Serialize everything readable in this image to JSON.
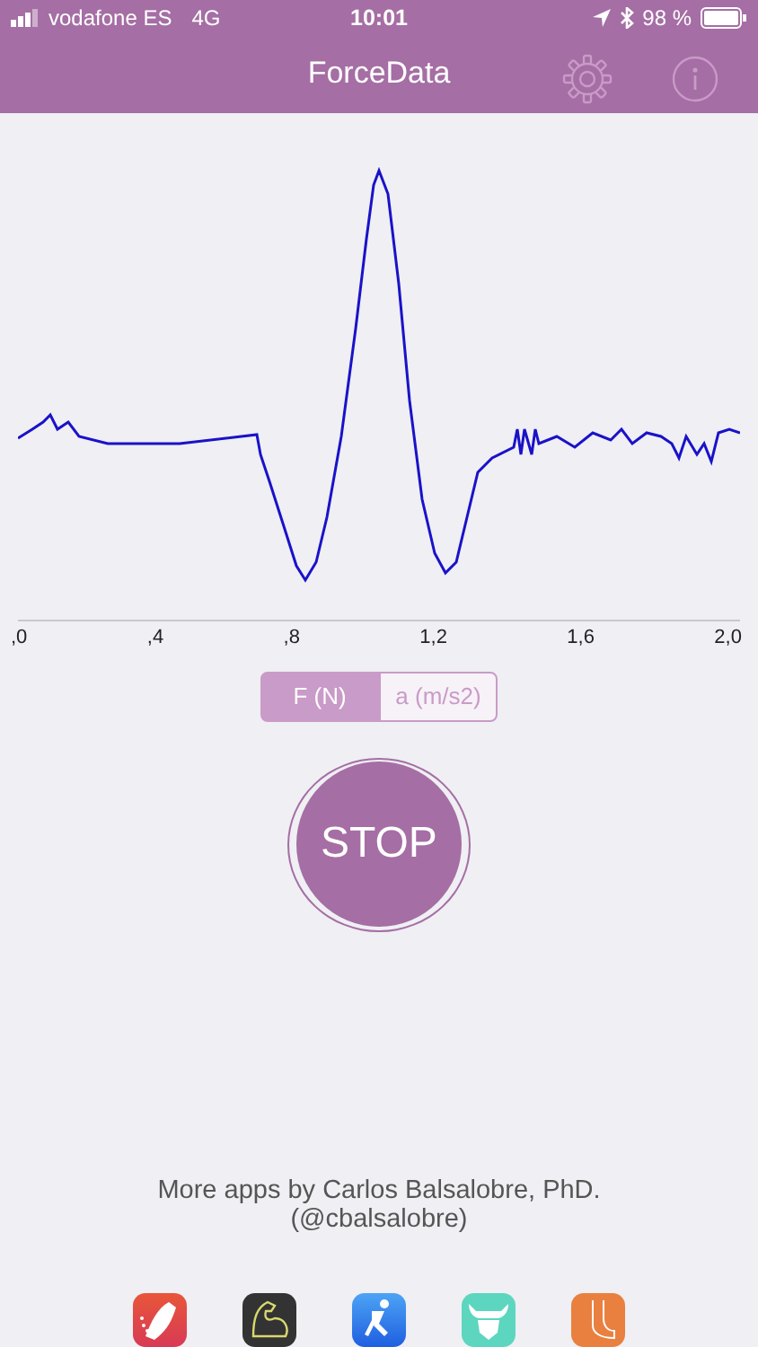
{
  "status_bar": {
    "carrier": "vodafone ES",
    "network": "4G",
    "time": "10:01",
    "battery": "98 %"
  },
  "header": {
    "title": "ForceData"
  },
  "chart": {
    "x_labels": [
      ",0",
      ",4",
      ",8",
      "1,2",
      "1,6",
      "2,0"
    ]
  },
  "segments": [
    {
      "label": "F (N)",
      "selected": true
    },
    {
      "label": "a (m/s2)",
      "selected": false
    }
  ],
  "stop_button": {
    "label": "STOP"
  },
  "credits": {
    "line_1": "More apps by Carlos Balsalobre, PhD.",
    "line_2": "(@cbalsalobre)"
  }
}
